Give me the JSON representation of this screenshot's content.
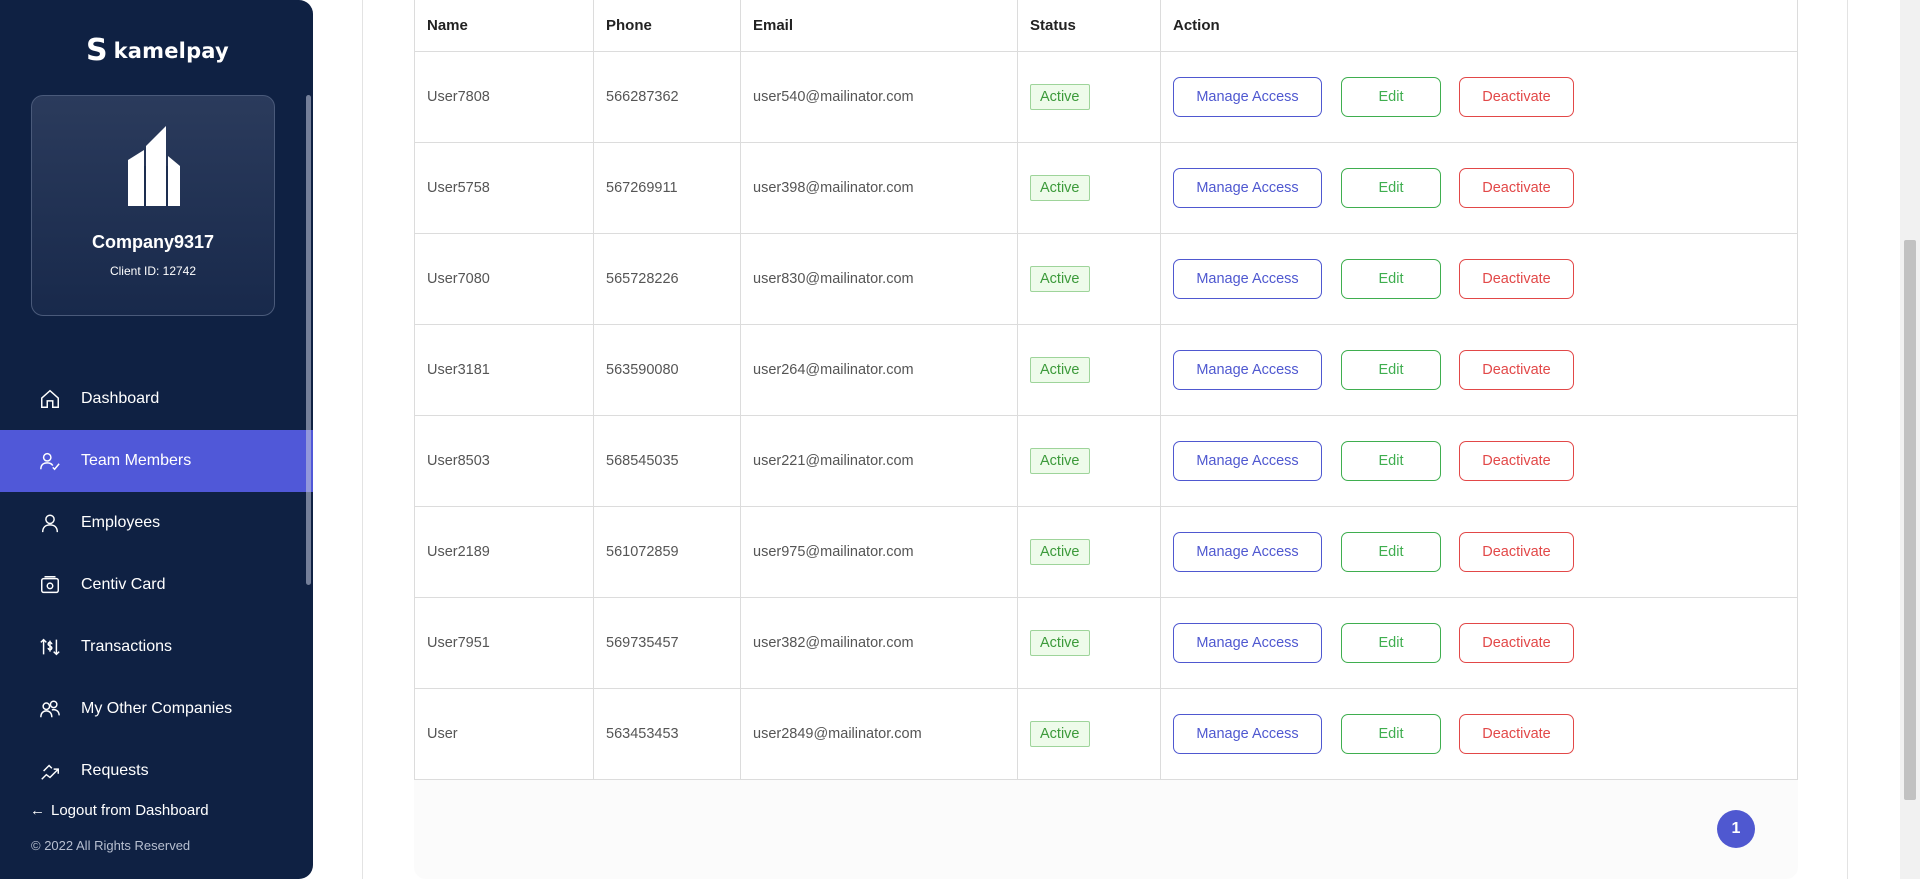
{
  "brand": {
    "name": "kamelpay"
  },
  "company": {
    "name": "Company9317",
    "client_id": "Client ID: 12742"
  },
  "nav": [
    {
      "label": "Dashboard",
      "icon": "home-icon",
      "active": false
    },
    {
      "label": "Team Members",
      "icon": "user-check-icon",
      "active": true
    },
    {
      "label": "Employees",
      "icon": "user-icon",
      "active": false
    },
    {
      "label": "Centiv Card",
      "icon": "card-icon",
      "active": false
    },
    {
      "label": "Transactions",
      "icon": "transactions-icon",
      "active": false
    },
    {
      "label": "My Other Companies",
      "icon": "users-icon",
      "active": false
    },
    {
      "label": "Requests",
      "icon": "requests-icon",
      "active": false
    }
  ],
  "logout_label": "Logout from Dashboard",
  "copyright": "© 2022 All Rights Reserved",
  "table": {
    "headers": {
      "name": "Name",
      "phone": "Phone",
      "email": "Email",
      "status": "Status",
      "action": "Action"
    },
    "rows": [
      {
        "name": "User7808",
        "phone": "566287362",
        "email": "user540@mailinator.com",
        "status": "Active"
      },
      {
        "name": "User5758",
        "phone": "567269911",
        "email": "user398@mailinator.com",
        "status": "Active"
      },
      {
        "name": "User7080",
        "phone": "565728226",
        "email": "user830@mailinator.com",
        "status": "Active"
      },
      {
        "name": "User3181",
        "phone": "563590080",
        "email": "user264@mailinator.com",
        "status": "Active"
      },
      {
        "name": "User8503",
        "phone": "568545035",
        "email": "user221@mailinator.com",
        "status": "Active"
      },
      {
        "name": "User2189",
        "phone": "561072859",
        "email": "user975@mailinator.com",
        "status": "Active"
      },
      {
        "name": "User7951",
        "phone": "569735457",
        "email": "user382@mailinator.com",
        "status": "Active"
      },
      {
        "name": "User",
        "phone": "563453453",
        "email": "user2849@mailinator.com",
        "status": "Active"
      }
    ],
    "actions": {
      "manage": "Manage Access",
      "edit": "Edit",
      "deactivate": "Deactivate"
    }
  },
  "pagination": {
    "current": "1"
  },
  "colors": {
    "sidebar_bg": "#0f2143",
    "accent": "#5058d8",
    "success": "#3fae4f",
    "danger": "#e24848"
  }
}
